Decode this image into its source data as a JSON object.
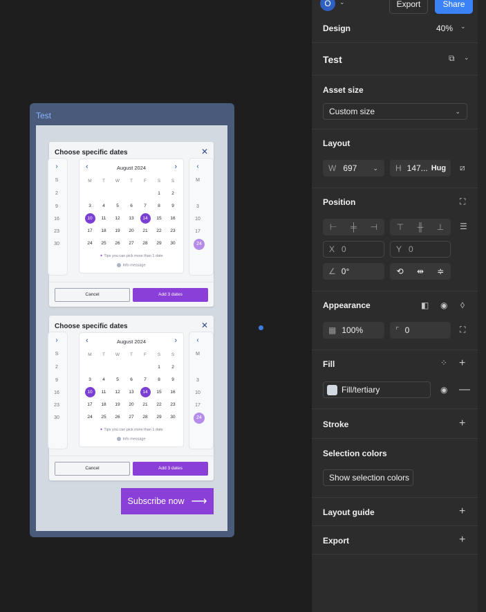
{
  "canvas": {
    "frame_label": "Test",
    "modals": [
      {
        "title": "Choose specific dates",
        "month": "August 2024",
        "weekdays": [
          "M",
          "T",
          "W",
          "T",
          "F",
          "S",
          "S"
        ],
        "days": [
          "",
          "",
          "",
          "",
          "",
          "1",
          "2",
          "3",
          "4",
          "5",
          "6",
          "7",
          "8",
          "9",
          "10",
          "11",
          "12",
          "13",
          "14",
          "15",
          "16",
          "17",
          "18",
          "19",
          "20",
          "21",
          "22",
          "23",
          "24",
          "25",
          "26",
          "27",
          "28",
          "29",
          "30"
        ],
        "selected_days": [
          "10",
          "14"
        ],
        "tip": "Tips you can pick more than 1 date",
        "info": "Info message",
        "cancel": "Cancel",
        "add": "Add 3 dates",
        "left_cal": [
          "S",
          "2",
          "9",
          "16",
          "23",
          "30"
        ],
        "right_cal": [
          "M",
          "3",
          "10",
          "17",
          "24"
        ]
      },
      {
        "title": "Choose specific dates",
        "month": "August 2024",
        "weekdays": [
          "M",
          "T",
          "W",
          "T",
          "F",
          "S",
          "S"
        ],
        "days": [
          "",
          "",
          "",
          "",
          "",
          "1",
          "2",
          "3",
          "4",
          "5",
          "6",
          "7",
          "8",
          "9",
          "10",
          "11",
          "12",
          "13",
          "14",
          "15",
          "16",
          "17",
          "18",
          "19",
          "20",
          "21",
          "22",
          "23",
          "24",
          "25",
          "26",
          "27",
          "28",
          "29",
          "30"
        ],
        "selected_days": [
          "10",
          "14"
        ],
        "tip": "Tips you can pick more than 1 date",
        "info": "Info message",
        "cancel": "Cancel",
        "add": "Add 3 dates",
        "left_cal": [
          "S",
          "2",
          "9",
          "16",
          "23",
          "30"
        ],
        "right_cal": [
          "M",
          "3",
          "10",
          "17",
          "24"
        ]
      }
    ],
    "subscribe": "Subscribe now",
    "accent": "#8a3fd9"
  },
  "panel": {
    "avatar": "O",
    "export_btn": "Export",
    "share_btn": "Share",
    "design_tab": "Design",
    "zoom": "40%",
    "layer_name": "Test",
    "asset_size": {
      "label": "Asset size",
      "value": "Custom size"
    },
    "layout": {
      "label": "Layout",
      "w_label": "W",
      "w_value": "697",
      "h_label": "H",
      "h_value": "147...",
      "h_mode": "Hug"
    },
    "position": {
      "label": "Position",
      "x_label": "X",
      "x_value": "0",
      "y_label": "Y",
      "y_value": "0",
      "rotation": "0°"
    },
    "appearance": {
      "label": "Appearance",
      "opacity": "100%",
      "radius": "0"
    },
    "fill": {
      "label": "Fill",
      "value": "Fill/tertiary"
    },
    "stroke": {
      "label": "Stroke"
    },
    "selection_colors": {
      "label": "Selection colors",
      "button": "Show selection colors"
    },
    "layout_guide": {
      "label": "Layout guide"
    },
    "export": {
      "label": "Export"
    }
  }
}
